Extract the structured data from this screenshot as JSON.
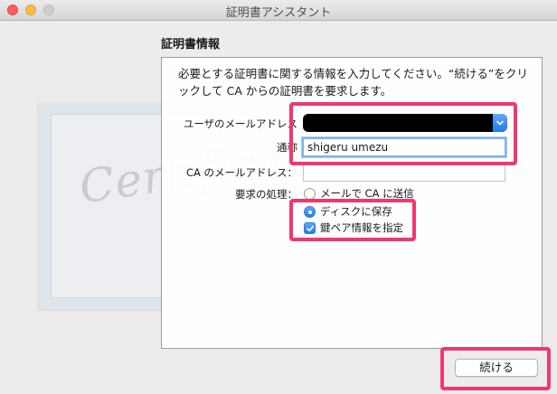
{
  "window": {
    "title": "証明書アシスタント"
  },
  "illustration": {
    "script_text": "Certificate"
  },
  "section": {
    "heading": "証明書情報"
  },
  "description": "必要とする証明書に関する情報を入力してください。“続ける”をクリックして CA からの証明書を要求します。",
  "form": {
    "email_label": "ユーザのメールアドレス",
    "email_value": "",
    "common_name_label": "通称",
    "common_name_value": "shigeru umezu",
    "ca_email_label": "CA のメールアドレス：",
    "ca_email_value": "",
    "request_label": "要求の処理：",
    "options": [
      {
        "label": "メールで CA に送信",
        "selected": false
      },
      {
        "label": "ディスクに保存",
        "selected": true
      }
    ],
    "specify_key_label": "鍵ペア情報を指定",
    "specify_key_checked": true
  },
  "buttons": {
    "continue_label": "続ける"
  },
  "colors": {
    "highlight": "#f0386b",
    "accent": "#1d7bf0"
  }
}
